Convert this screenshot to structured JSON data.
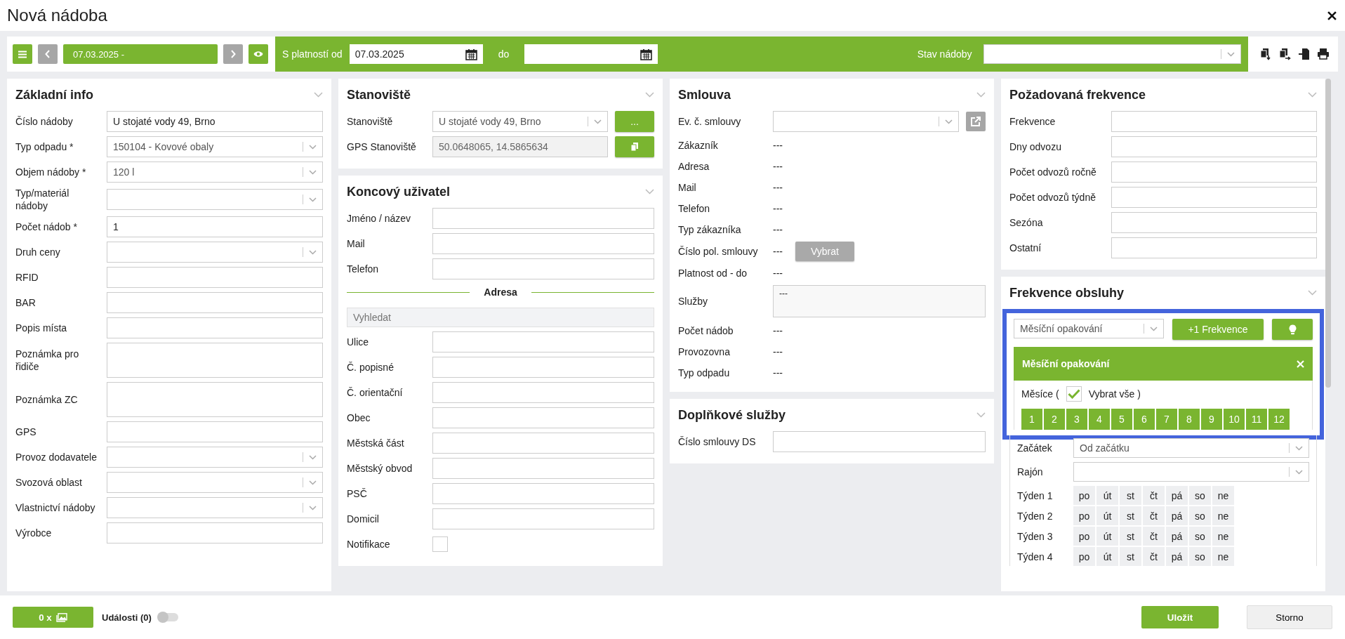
{
  "window": {
    "title": "Nová nádoba"
  },
  "toolbar": {
    "period": "07.03.2025 -",
    "valid_from_label": "S platností od",
    "valid_from": "07.03.2025",
    "to_label": "do",
    "state_label": "Stav nádoby"
  },
  "columns": [
    {
      "panels": [
        {
          "kind": "form",
          "title": "Základní info",
          "fields": [
            {
              "label": "Číslo nádoby",
              "kind": "text",
              "value": "U stojaté vody 49, Brno"
            },
            {
              "label": "Typ odpadu *",
              "kind": "select",
              "value": "150104 - Kovové obaly"
            },
            {
              "label": "Objem nádoby *",
              "kind": "select",
              "value": "120 l"
            },
            {
              "label": "Typ/materiál nádoby",
              "kind": "select"
            },
            {
              "label": "Počet nádob *",
              "kind": "text",
              "value": "1"
            },
            {
              "label": "Druh ceny",
              "kind": "select"
            },
            {
              "label": "RFID",
              "kind": "text"
            },
            {
              "label": "BAR",
              "kind": "text"
            },
            {
              "label": "Popis místa",
              "kind": "text"
            },
            {
              "label": "Poznámka pro řidiče",
              "kind": "textarea"
            },
            {
              "label": "Poznámka ZC",
              "kind": "textarea"
            },
            {
              "label": "GPS",
              "kind": "text"
            },
            {
              "label": "Provoz dodavatele",
              "kind": "select"
            },
            {
              "label": "Svozová oblast",
              "kind": "select"
            },
            {
              "label": "Vlastnictví nádoby",
              "kind": "select"
            },
            {
              "label": "Výrobce",
              "kind": "text"
            }
          ]
        }
      ]
    },
    {
      "panels": [
        {
          "kind": "form",
          "title": "Stanoviště",
          "fields": [
            {
              "label": "Stanoviště",
              "kind": "select",
              "value": "U stojaté vody 49, Brno",
              "button": {
                "label": "...",
                "disabled": false
              }
            },
            {
              "label": "GPS Stanoviště",
              "kind": "readonly",
              "value": "50.0648065, 14.5865634",
              "copy_button": true
            }
          ]
        },
        {
          "kind": "form",
          "title": "Koncový uživatel",
          "fields": [
            {
              "label": "Jméno / název",
              "kind": "text"
            },
            {
              "label": "Mail",
              "kind": "text"
            },
            {
              "label": "Telefon",
              "kind": "text"
            },
            {
              "label": "Adresa",
              "kind": "divider"
            },
            {
              "placeholder": "Vyhledat",
              "kind": "search"
            },
            {
              "label": "Ulice",
              "kind": "text"
            },
            {
              "label": "Č. popisné",
              "kind": "text"
            },
            {
              "label": "Č. orientační",
              "kind": "text"
            },
            {
              "label": "Obec",
              "kind": "text"
            },
            {
              "label": "Městská část",
              "kind": "text"
            },
            {
              "label": "Městský obvod",
              "kind": "text"
            },
            {
              "label": "PSČ",
              "kind": "text"
            },
            {
              "label": "Domicil",
              "kind": "text"
            },
            {
              "label": "Notifikace",
              "kind": "checkbox",
              "checked": false
            }
          ]
        }
      ]
    },
    {
      "panels": [
        {
          "kind": "form",
          "title": "Smlouva",
          "fields": [
            {
              "label": "Ev. č. smlouvy",
              "kind": "select",
              "link_button": true
            },
            {
              "label": "Zákazník",
              "kind": "display",
              "value": "---"
            },
            {
              "label": "Adresa",
              "kind": "display",
              "value": "---"
            },
            {
              "label": "Mail",
              "kind": "display",
              "value": "---"
            },
            {
              "label": "Telefon",
              "kind": "display",
              "value": "---"
            },
            {
              "label": "Typ zákazníka",
              "kind": "display",
              "value": "---"
            },
            {
              "label": "Číslo pol. smlouvy",
              "kind": "display",
              "value": "---",
              "button": {
                "label": "Vybrat",
                "disabled": true
              }
            },
            {
              "label": "Platnost od - do",
              "kind": "display",
              "value": "---"
            },
            {
              "label": "Služby",
              "kind": "displaybox",
              "value": "---"
            },
            {
              "label": "Počet nádob",
              "kind": "display",
              "value": "---"
            },
            {
              "label": "Provozovna",
              "kind": "display",
              "value": "---"
            },
            {
              "label": "Typ odpadu",
              "kind": "display",
              "value": "---"
            }
          ]
        },
        {
          "kind": "form",
          "title": "Doplňkové služby",
          "fields": [
            {
              "label": "Číslo smlouvy DS",
              "kind": "text"
            }
          ]
        }
      ]
    },
    {
      "panels": [
        {
          "kind": "form",
          "title": "Požadovaná frekvence",
          "fields": [
            {
              "label": "Frekvence",
              "kind": "text"
            },
            {
              "label": "Dny odvozu",
              "kind": "text"
            },
            {
              "label": "Počet odvozů ročně",
              "kind": "text"
            },
            {
              "label": "Počet odvozů týdně",
              "kind": "text"
            },
            {
              "label": "Sezóna",
              "kind": "text"
            },
            {
              "label": "Ostatní",
              "kind": "text"
            }
          ]
        },
        {
          "kind": "frequency",
          "title": "Frekvence obsluhy",
          "highlighted": true,
          "type_select": "Měsíční opakování",
          "add_button": "+1 Frekvence",
          "block_title": "Měsíční opakování",
          "months_label": "Měsíce (",
          "select_all": {
            "label": "Vybrat vše )",
            "checked": true
          },
          "months": [
            {
              "label": "1",
              "selected": true
            },
            {
              "label": "2",
              "selected": true
            },
            {
              "label": "3",
              "selected": true
            },
            {
              "label": "4",
              "selected": true
            },
            {
              "label": "5",
              "selected": true
            },
            {
              "label": "6",
              "selected": true
            },
            {
              "label": "7",
              "selected": true
            },
            {
              "label": "8",
              "selected": true
            },
            {
              "label": "9",
              "selected": true
            },
            {
              "label": "10",
              "selected": true
            },
            {
              "label": "11",
              "selected": true
            },
            {
              "label": "12",
              "selected": true
            }
          ],
          "start": {
            "label": "Začátek",
            "value": "Od začátku"
          },
          "district": {
            "label": "Rajón"
          },
          "weeks": [
            {
              "label": "Týden 1",
              "days": [
                {
                  "label": "po",
                  "selected": false
                },
                {
                  "label": "út",
                  "selected": false
                },
                {
                  "label": "st",
                  "selected": false
                },
                {
                  "label": "čt",
                  "selected": false
                },
                {
                  "label": "pá",
                  "selected": false
                },
                {
                  "label": "so",
                  "selected": false
                },
                {
                  "label": "ne",
                  "selected": false
                }
              ]
            },
            {
              "label": "Týden 2",
              "days": [
                {
                  "label": "po",
                  "selected": false
                },
                {
                  "label": "út",
                  "selected": false
                },
                {
                  "label": "st",
                  "selected": false
                },
                {
                  "label": "čt",
                  "selected": false
                },
                {
                  "label": "pá",
                  "selected": false
                },
                {
                  "label": "so",
                  "selected": false
                },
                {
                  "label": "ne",
                  "selected": false
                }
              ]
            },
            {
              "label": "Týden 3",
              "days": [
                {
                  "label": "po",
                  "selected": false
                },
                {
                  "label": "út",
                  "selected": false
                },
                {
                  "label": "st",
                  "selected": false
                },
                {
                  "label": "čt",
                  "selected": false
                },
                {
                  "label": "pá",
                  "selected": false
                },
                {
                  "label": "so",
                  "selected": false
                },
                {
                  "label": "ne",
                  "selected": false
                }
              ]
            },
            {
              "label": "Týden 4",
              "days": [
                {
                  "label": "po",
                  "selected": false
                },
                {
                  "label": "út",
                  "selected": false
                },
                {
                  "label": "st",
                  "selected": false
                },
                {
                  "label": "čt",
                  "selected": false
                },
                {
                  "label": "pá",
                  "selected": false
                },
                {
                  "label": "so",
                  "selected": false
                },
                {
                  "label": "ne",
                  "selected": false
                }
              ]
            }
          ]
        }
      ]
    }
  ],
  "footer": {
    "photos_button": "0 x",
    "events": {
      "label": "Události (0)",
      "on": false
    },
    "save": "Uložit",
    "cancel": "Storno"
  }
}
